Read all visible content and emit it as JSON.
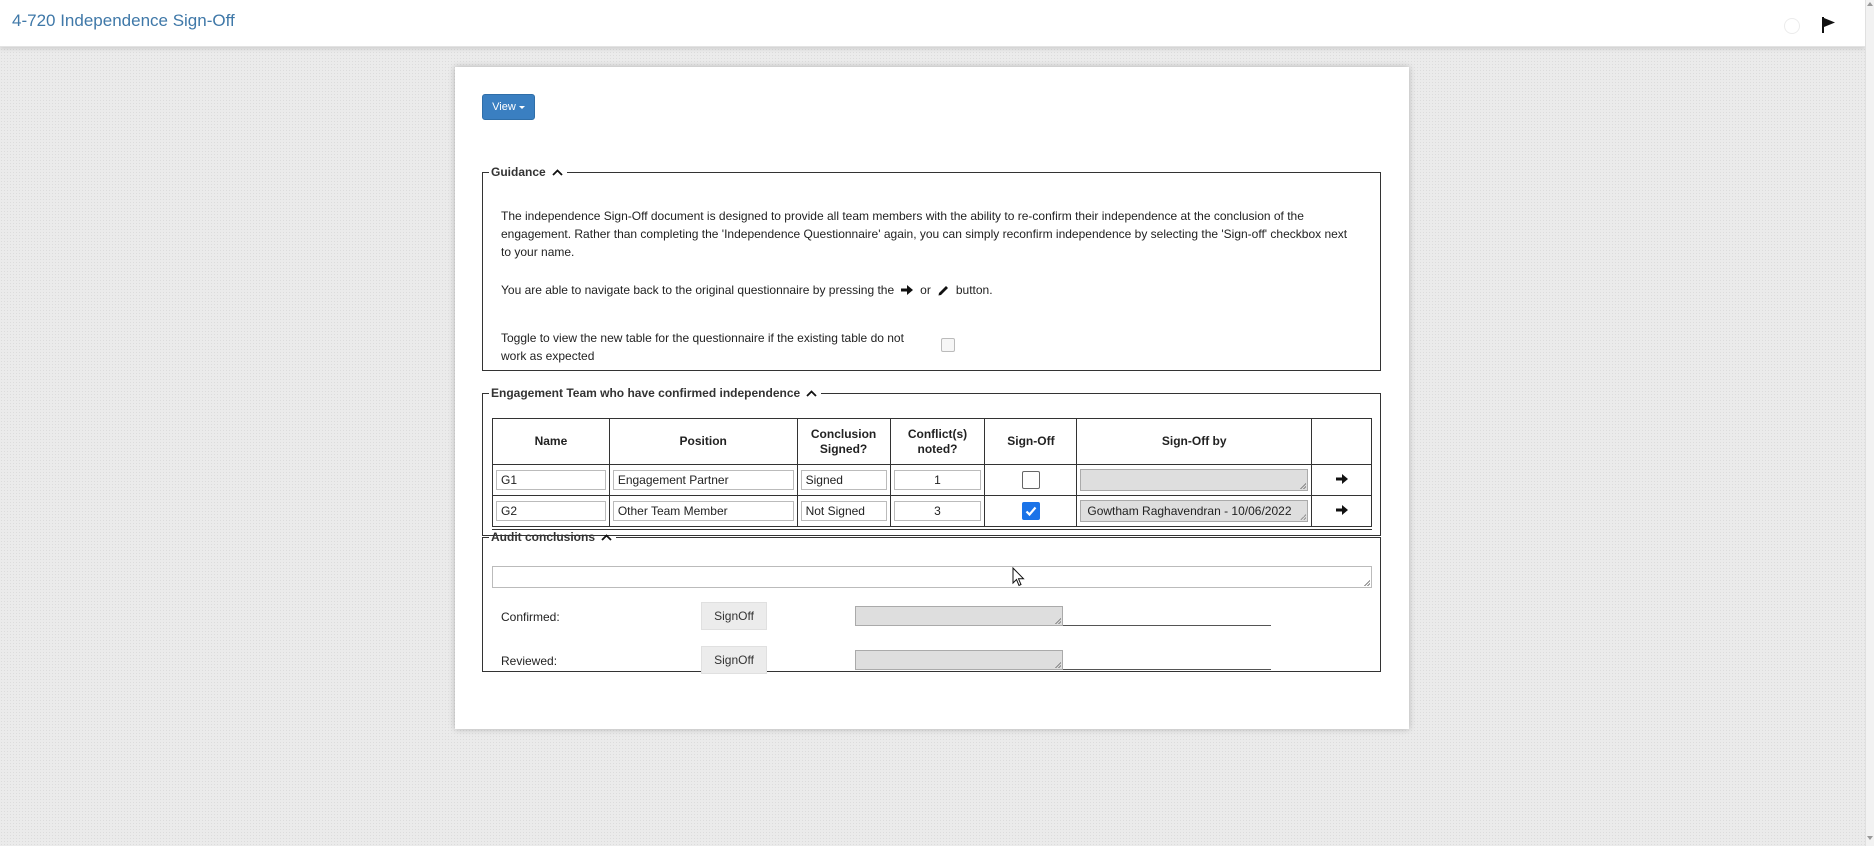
{
  "header": {
    "title": "4-720 Independence Sign-Off"
  },
  "toolbar": {
    "view_label": "View"
  },
  "guidance": {
    "legend": "Guidance",
    "paragraph1": "The independence Sign-Off document is designed to provide all team members with the ability to re-confirm their independence at the conclusion of the engagement. Rather than completing the 'Independence Questionnaire' again, you can simply reconfirm independence by selecting the 'Sign-off' checkbox next to your name.",
    "paragraph2_before": "You are able to navigate back to the original questionnaire by pressing the",
    "paragraph2_or": "or",
    "paragraph2_after": "button.",
    "toggle_text": "Toggle to view the new table for the questionnaire if the existing table do not work as expected",
    "toggle_checked": false
  },
  "team": {
    "legend": "Engagement Team who have confirmed independence",
    "columns": [
      "Name",
      "Position",
      "Conclusion Signed?",
      "Conflict(s) noted?",
      "Sign-Off",
      "Sign-Off by",
      ""
    ],
    "rows": [
      {
        "name": "G1",
        "position": "Engagement Partner",
        "conclusion": "Signed",
        "conflicts": "1",
        "signed_off": false,
        "signed_by": ""
      },
      {
        "name": "G2",
        "position": "Other Team Member",
        "conclusion": "Not Signed",
        "conflicts": "3",
        "signed_off": true,
        "signed_by": "Gowtham Raghavendran - 10/06/2022"
      }
    ]
  },
  "audit": {
    "legend": "Audit conclusions",
    "text_value": "",
    "confirmed_label": "Confirmed:",
    "reviewed_label": "Reviewed:",
    "signoff_label": "SignOff"
  },
  "colors": {
    "accent": "#3a7fc1",
    "title": "#3f78a8",
    "checkbox_checked": "#1a73e8"
  },
  "icons": [
    "flag-icon",
    "spinner-icon",
    "arrow-right-icon",
    "pencil-icon",
    "chevron-up-icon",
    "caret-down-icon"
  ]
}
